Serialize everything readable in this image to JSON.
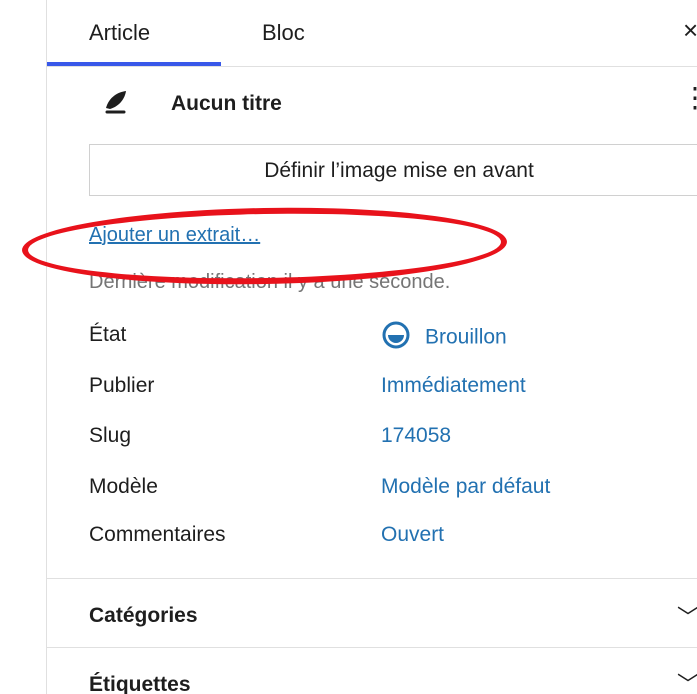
{
  "tabs": {
    "article": "Article",
    "bloc": "Bloc",
    "close_symbol": "×"
  },
  "post": {
    "title": "Aucun titre",
    "more_symbol": "⋮",
    "featured_image_button": "Définir l’image mise en avant",
    "add_excerpt_link": "Ajouter un extrait…",
    "last_modified": "Dernière modification il y a une seconde."
  },
  "meta": {
    "status": {
      "label": "État",
      "value": "Brouillon"
    },
    "publish": {
      "label": "Publier",
      "value": "Immédiatement"
    },
    "slug": {
      "label": "Slug",
      "value": "174058"
    },
    "template": {
      "label": "Modèle",
      "value": "Modèle par défaut"
    },
    "comments": {
      "label": "Commentaires",
      "value": "Ouvert"
    }
  },
  "panels": {
    "categories": "Catégories",
    "tags": "Étiquettes",
    "chevron_symbol": "﹀"
  },
  "colors": {
    "accent": "#3858e9",
    "link": "#2271b1",
    "annotation": "#e8121b",
    "muted_text": "#757575"
  },
  "icons": {
    "feather": "feather-icon",
    "status": "draft-status-icon",
    "more": "more-vertical-icon",
    "close": "close-icon",
    "chevron": "chevron-down-icon"
  }
}
